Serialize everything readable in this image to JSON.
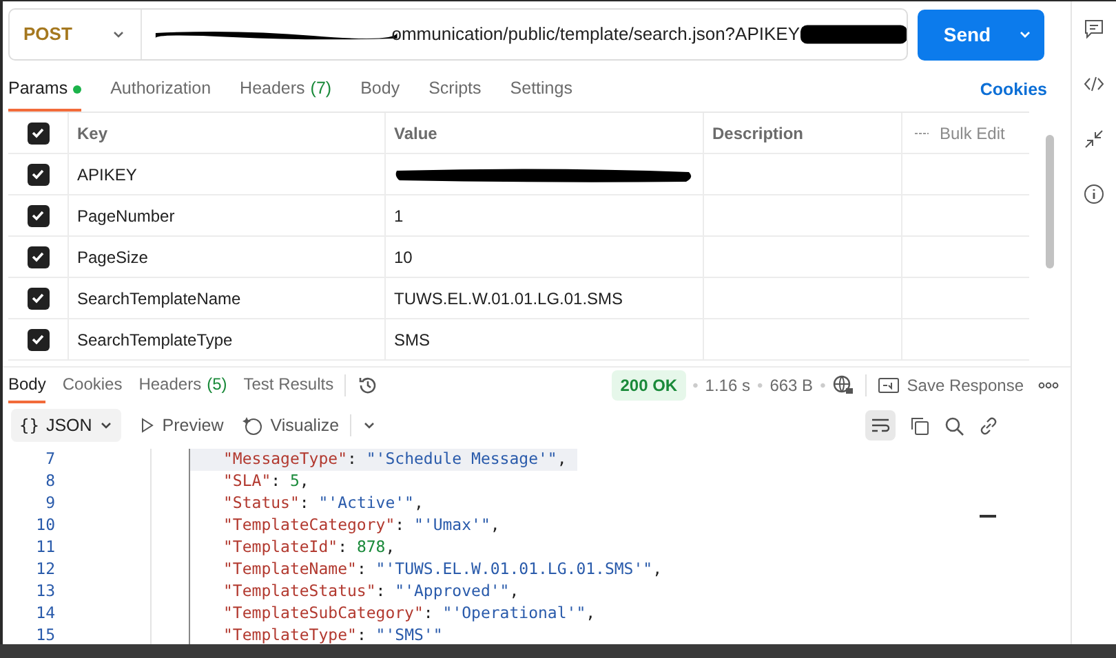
{
  "request": {
    "method": "POST",
    "url_visible": "ommunication/public/template/search.json?APIKEY",
    "send": "Send"
  },
  "request_tabs": [
    {
      "label": "Params",
      "selected": true,
      "dot": true
    },
    {
      "label": "Authorization",
      "selected": false
    },
    {
      "label": "Headers",
      "count": "(7)",
      "selected": false
    },
    {
      "label": "Body",
      "selected": false
    },
    {
      "label": "Scripts",
      "selected": false
    },
    {
      "label": "Settings",
      "selected": false
    }
  ],
  "cookies_link": "Cookies",
  "params": {
    "columns": [
      "Key",
      "Value",
      "Description"
    ],
    "bulk_edit": "Bulk Edit",
    "header_checked": true,
    "rows": [
      {
        "checked": true,
        "key": "APIKEY",
        "value": "",
        "redacted": true
      },
      {
        "checked": true,
        "key": "PageNumber",
        "value": "1"
      },
      {
        "checked": true,
        "key": "PageSize",
        "value": "10"
      },
      {
        "checked": true,
        "key": "SearchTemplateName",
        "value": "TUWS.EL.W.01.01.LG.01.SMS"
      },
      {
        "checked": true,
        "key": "SearchTemplateType",
        "value": "SMS"
      }
    ]
  },
  "response_tabs": [
    {
      "label": "Body",
      "selected": true
    },
    {
      "label": "Cookies",
      "selected": false
    },
    {
      "label": "Headers",
      "count": "(5)",
      "selected": false
    },
    {
      "label": "Test Results",
      "selected": false
    }
  ],
  "status": {
    "separator": "•",
    "code": "200 OK",
    "time": "1.16 s",
    "size": "663 B",
    "save": "Save Response"
  },
  "format": {
    "brace": "{}",
    "type": "JSON",
    "preview": "Preview",
    "visualize": "Visualize"
  },
  "code_punct": {
    "colon": ": ",
    "comma": ","
  },
  "code_lines": [
    {
      "number": "7",
      "key": "\"MessageType\"",
      "value": "\"'Schedule Message'\"",
      "kind": "string",
      "highlighted": true
    },
    {
      "number": "8",
      "key": "\"SLA\"",
      "value": "5",
      "kind": "number",
      "highlighted": false
    },
    {
      "number": "9",
      "key": "\"Status\"",
      "value": "\"'Active'\"",
      "kind": "string",
      "highlighted": false
    },
    {
      "number": "10",
      "key": "\"TemplateCategory\"",
      "value": "\"'Umax'\"",
      "kind": "string",
      "highlighted": false
    },
    {
      "number": "11",
      "key": "\"TemplateId\"",
      "value": "878",
      "kind": "number",
      "highlighted": false
    },
    {
      "number": "12",
      "key": "\"TemplateName\"",
      "value": "\"'TUWS.EL.W.01.01.LG.01.SMS'\"",
      "kind": "string",
      "highlighted": false
    },
    {
      "number": "13",
      "key": "\"TemplateStatus\"",
      "value": "\"'Approved'\"",
      "kind": "string",
      "highlighted": false
    },
    {
      "number": "14",
      "key": "\"TemplateSubCategory\"",
      "value": "\"'Operational'\"",
      "kind": "string",
      "highlighted": false
    },
    {
      "number": "15",
      "key": "\"TemplateType\"",
      "value": "\"'SMS'\"",
      "kind": "string",
      "highlighted": false
    }
  ]
}
